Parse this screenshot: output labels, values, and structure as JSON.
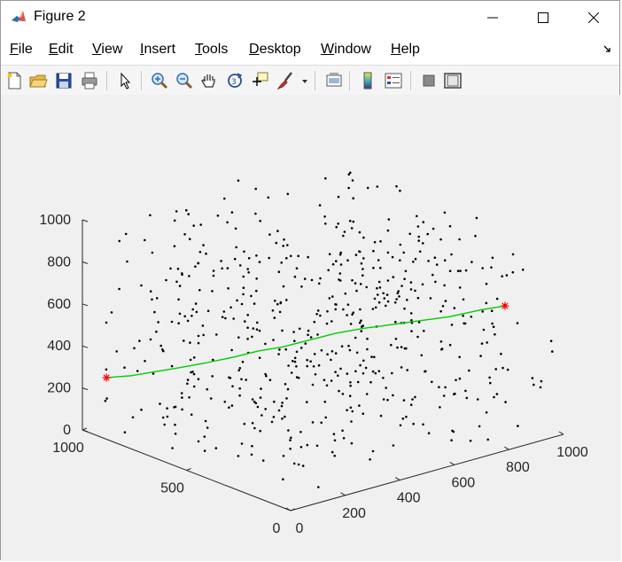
{
  "window": {
    "title": "Figure 2",
    "controls": [
      "minimize",
      "maximize",
      "close"
    ]
  },
  "menu": {
    "items": [
      {
        "label": "File",
        "accel": "F",
        "rest": "ile"
      },
      {
        "label": "Edit",
        "accel": "E",
        "rest": "dit"
      },
      {
        "label": "View",
        "accel": "V",
        "rest": "iew"
      },
      {
        "label": "Insert",
        "accel": "I",
        "rest": "nsert"
      },
      {
        "label": "Tools",
        "accel": "T",
        "rest": "ools"
      },
      {
        "label": "Desktop",
        "accel": "D",
        "rest": "esktop"
      },
      {
        "label": "Window",
        "accel": "W",
        "rest": "indow"
      },
      {
        "label": "Help",
        "accel": "H",
        "rest": "elp"
      }
    ]
  },
  "toolbar": {
    "icons": [
      "new-figure-icon",
      "open-icon",
      "save-icon",
      "print-icon",
      "select-arrow-icon",
      "zoom-in-icon",
      "zoom-out-icon",
      "pan-hand-icon",
      "rotate-3d-icon",
      "data-cursor-icon",
      "brush-icon",
      "brush-dropdown-icon",
      "link-plot-icon",
      "colorbar-icon",
      "legend-icon",
      "hide-plot-tools-icon",
      "show-plot-tools-icon"
    ]
  },
  "colors": {
    "path": "#00cc00",
    "endpoints": "#ff0000",
    "points": "#000000",
    "axes": "#262626"
  },
  "chart_data": {
    "type": "scatter",
    "title": "",
    "xlabel": "",
    "ylabel": "",
    "zlabel": "",
    "xlim": [
      0,
      1000
    ],
    "ylim": [
      0,
      1000
    ],
    "zlim": [
      0,
      1000
    ],
    "x_ticks": [
      "0",
      "200",
      "400",
      "600",
      "800",
      "1000"
    ],
    "y_ticks": [
      "0",
      "500",
      "1000"
    ],
    "z_ticks": [
      "0",
      "200",
      "400",
      "600",
      "800",
      "1000"
    ],
    "grid": false,
    "view": "3d-default",
    "series": [
      {
        "type": "scatter3",
        "marker": ".",
        "color": "#000000",
        "count": 600,
        "distribution": "uniform random in [0,1000]^3"
      },
      {
        "type": "line3",
        "color": "#00cc00",
        "points": [
          [
            50,
            950,
            250
          ],
          [
            100,
            900,
            260
          ],
          [
            150,
            850,
            280
          ],
          [
            200,
            800,
            300
          ],
          [
            260,
            750,
            320
          ],
          [
            320,
            690,
            350
          ],
          [
            370,
            640,
            380
          ],
          [
            420,
            590,
            400
          ],
          [
            480,
            540,
            430
          ],
          [
            540,
            490,
            460
          ],
          [
            600,
            440,
            480
          ],
          [
            660,
            380,
            500
          ],
          [
            720,
            320,
            520
          ],
          [
            780,
            260,
            540
          ],
          [
            850,
            200,
            570
          ],
          [
            900,
            150,
            590
          ]
        ]
      },
      {
        "type": "endpoints",
        "marker": "*",
        "color": "#ff0000",
        "points": [
          [
            50,
            950,
            250
          ],
          [
            900,
            150,
            590
          ]
        ]
      }
    ]
  }
}
